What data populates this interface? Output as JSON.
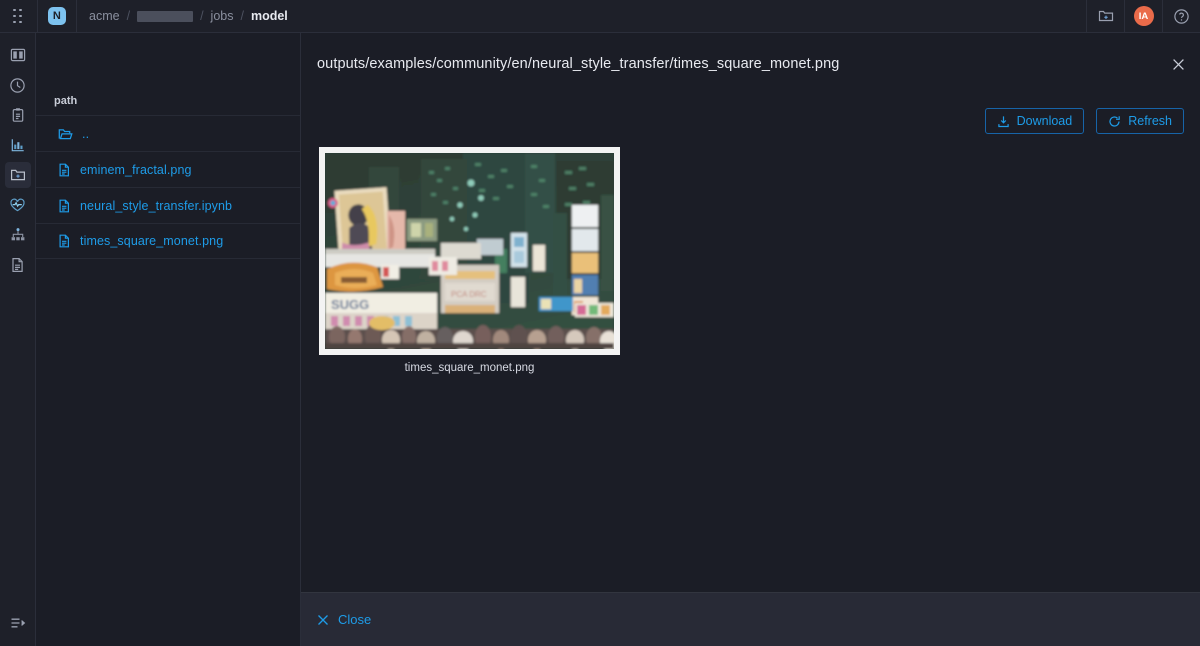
{
  "topbar": {
    "grip_icon": "grip-dots-icon",
    "logo_text": "N",
    "breadcrumbs": [
      {
        "label": "acme",
        "current": false,
        "redacted": false
      },
      {
        "label": "",
        "current": false,
        "redacted": true
      },
      {
        "label": "jobs",
        "current": false,
        "redacted": false
      },
      {
        "label": "model",
        "current": true,
        "redacted": false
      }
    ],
    "separator": "/",
    "folder_icon": "folder-add-icon",
    "avatar_initials": "IA",
    "help_icon": "help-circle-icon"
  },
  "sidebar": {
    "items": [
      {
        "name": "sidebar-item-panels",
        "icon": "panels-icon",
        "active": false
      },
      {
        "name": "sidebar-item-history",
        "icon": "clock-icon",
        "active": false
      },
      {
        "name": "sidebar-item-reports",
        "icon": "clipboard-icon",
        "active": false
      },
      {
        "name": "sidebar-item-metrics",
        "icon": "chart-bar-icon",
        "active": false
      },
      {
        "name": "sidebar-item-files",
        "icon": "folder-add-icon",
        "active": true
      },
      {
        "name": "sidebar-item-health",
        "icon": "heart-pulse-icon",
        "active": false
      },
      {
        "name": "sidebar-item-topology",
        "icon": "sitemap-icon",
        "active": false
      },
      {
        "name": "sidebar-item-logs",
        "icon": "document-icon",
        "active": false
      }
    ],
    "collapse_icon": "collapse-panel-icon"
  },
  "filepanel": {
    "column_header": "path",
    "rows": [
      {
        "label": "..",
        "icon": "folder-open-icon",
        "type": "dir"
      },
      {
        "label": "eminem_fractal.png",
        "icon": "file-icon",
        "type": "file"
      },
      {
        "label": "neural_style_transfer.ipynb",
        "icon": "file-icon",
        "type": "file"
      },
      {
        "label": "times_square_monet.png",
        "icon": "file-icon",
        "type": "file"
      }
    ]
  },
  "main": {
    "title": "outputs/examples/community/en/neural_style_transfer/times_square_monet.png",
    "close_icon": "close-icon",
    "toolbar": {
      "download_label": "Download",
      "download_icon": "download-icon",
      "refresh_label": "Refresh",
      "refresh_icon": "refresh-icon"
    },
    "preview": {
      "caption": "times_square_monet.png",
      "alt": "Times Square night scene rendered in Monet style"
    }
  },
  "footer": {
    "close_label": "Close",
    "close_icon": "close-icon"
  },
  "colors": {
    "accent_blue": "#1e9ce8",
    "background": "#1b1d26",
    "chrome": "#1e2029",
    "footer": "#282a36",
    "avatar": "#ea6b4a",
    "logo": "#7dc2ef",
    "border": "#2b2e3a"
  }
}
